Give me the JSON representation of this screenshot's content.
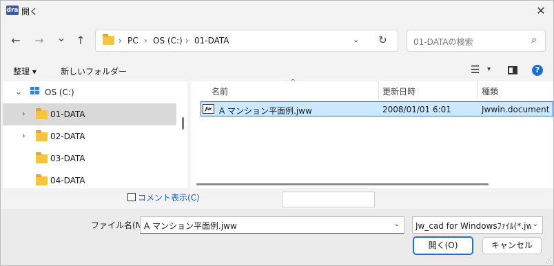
{
  "window": {
    "app_icon_text": "dra",
    "title": "開く",
    "close": "✕"
  },
  "nav": {
    "back": "←",
    "forward": "→",
    "recent": "⌄",
    "up": "↑",
    "crumbs": [
      "PC",
      "OS (C:)",
      "01-DATA"
    ],
    "refresh": "↻",
    "search_placeholder": "01-DATAの検索"
  },
  "command": {
    "organize": "整理 ▾",
    "new_folder": "新しいフォルダー",
    "view": "☰",
    "view_drop": "▾",
    "help": "?"
  },
  "tree": [
    {
      "label": "OS (C:)",
      "expanded": "⌄"
    },
    {
      "label": "01-DATA",
      "chevron": "›"
    },
    {
      "label": "02-DATA",
      "chevron": "›"
    },
    {
      "label": "03-DATA"
    },
    {
      "label": "04-DATA"
    }
  ],
  "columns": {
    "name": "名前",
    "date": "更新日時",
    "type": "種類",
    "sort": "^"
  },
  "files": [
    {
      "icon": "Jw",
      "name": "A マンション平面例.jww",
      "date": "2008/01/01 6:01",
      "type": "Jwwin.document"
    }
  ],
  "bottom": {
    "comment_label": "コメント表示(C)",
    "filename_label": "ファイル名(N):",
    "filename_value": "A マンション平面例.jww",
    "filetype_value": "Jw_cad for Windowsﾌｧｲﾙ(*.jww",
    "open_button": "開く(O)",
    "cancel_button": "キャンセル"
  }
}
